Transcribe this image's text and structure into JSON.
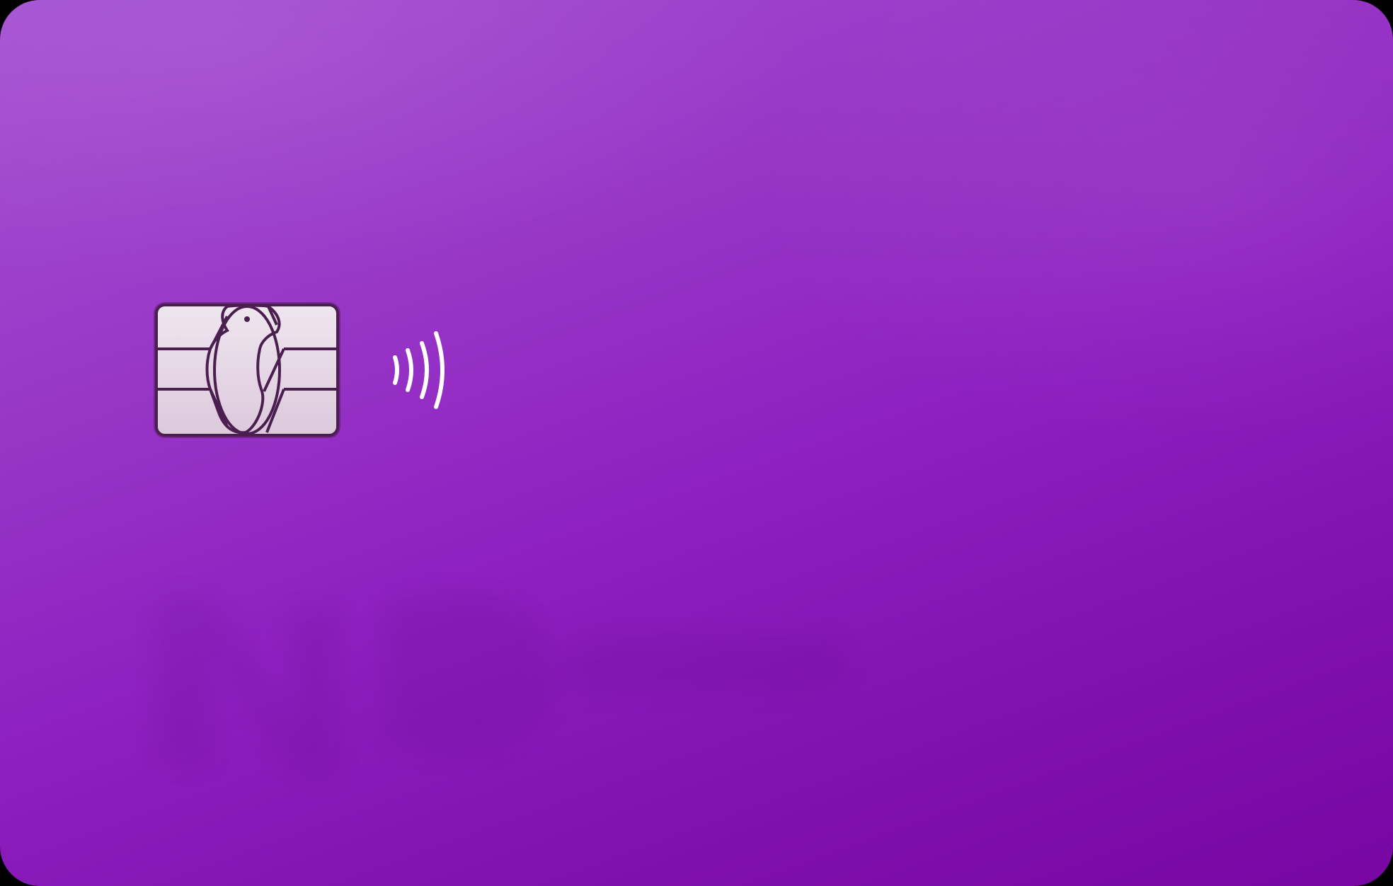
{
  "card": {
    "colors": {
      "top": "#a550d2",
      "middle": "#8d1fbf",
      "bottom": "#7706a3",
      "chip_fill": "#e8dbe8",
      "chip_line": "#4a1f4f",
      "contactless": "#ffffff"
    },
    "icons": {
      "chip": "emv-chip-icon",
      "contactless": "contactless-icon",
      "logo": "brand-logo-ghost"
    }
  }
}
